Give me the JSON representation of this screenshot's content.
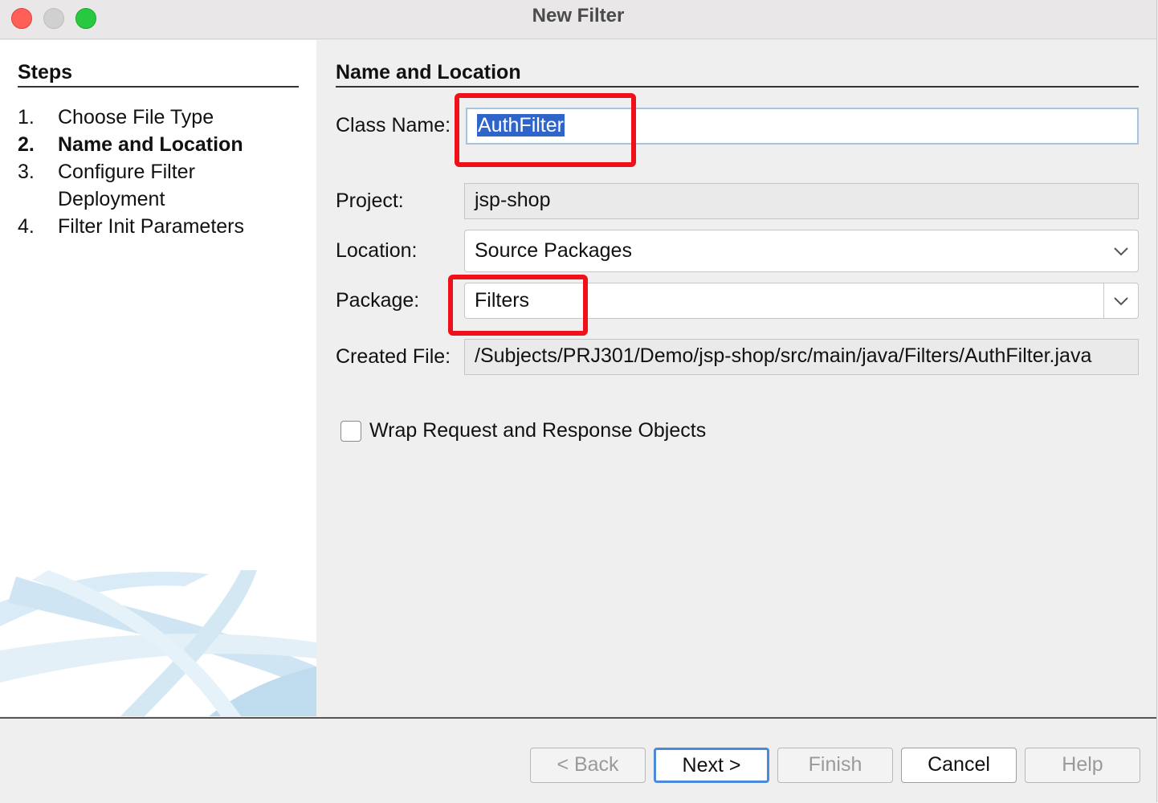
{
  "window": {
    "title": "New Filter"
  },
  "steps": {
    "title": "Steps",
    "items": [
      {
        "num": "1.",
        "label": "Choose File Type"
      },
      {
        "num": "2.",
        "label": "Name and Location"
      },
      {
        "num": "3.",
        "label": "Configure Filter",
        "label2": "Deployment"
      },
      {
        "num": "4.",
        "label": "Filter Init Parameters"
      }
    ],
    "current_step": 2
  },
  "form": {
    "section_title": "Name and Location",
    "class_name": {
      "label": "Class Name:",
      "value": "AuthFilter"
    },
    "project": {
      "label": "Project:",
      "value": "jsp-shop"
    },
    "location": {
      "label": "Location:",
      "value": "Source Packages"
    },
    "package": {
      "label": "Package:",
      "value": "Filters"
    },
    "created_file": {
      "label": "Created File:",
      "value": "/Subjects/PRJ301/Demo/jsp-shop/src/main/java/Filters/AuthFilter.java"
    },
    "wrap_checkbox": {
      "label": "Wrap Request and Response Objects",
      "checked": false
    }
  },
  "buttons": {
    "back": "< Back",
    "next": "Next >",
    "finish": "Finish",
    "cancel": "Cancel",
    "help": "Help"
  },
  "colors": {
    "highlight": "#f0101a",
    "selection": "#2f65ca",
    "focus_border": "#4a8ad8"
  },
  "icons": [
    "close-icon",
    "minimize-icon",
    "maximize-icon",
    "chevron-down-icon"
  ]
}
